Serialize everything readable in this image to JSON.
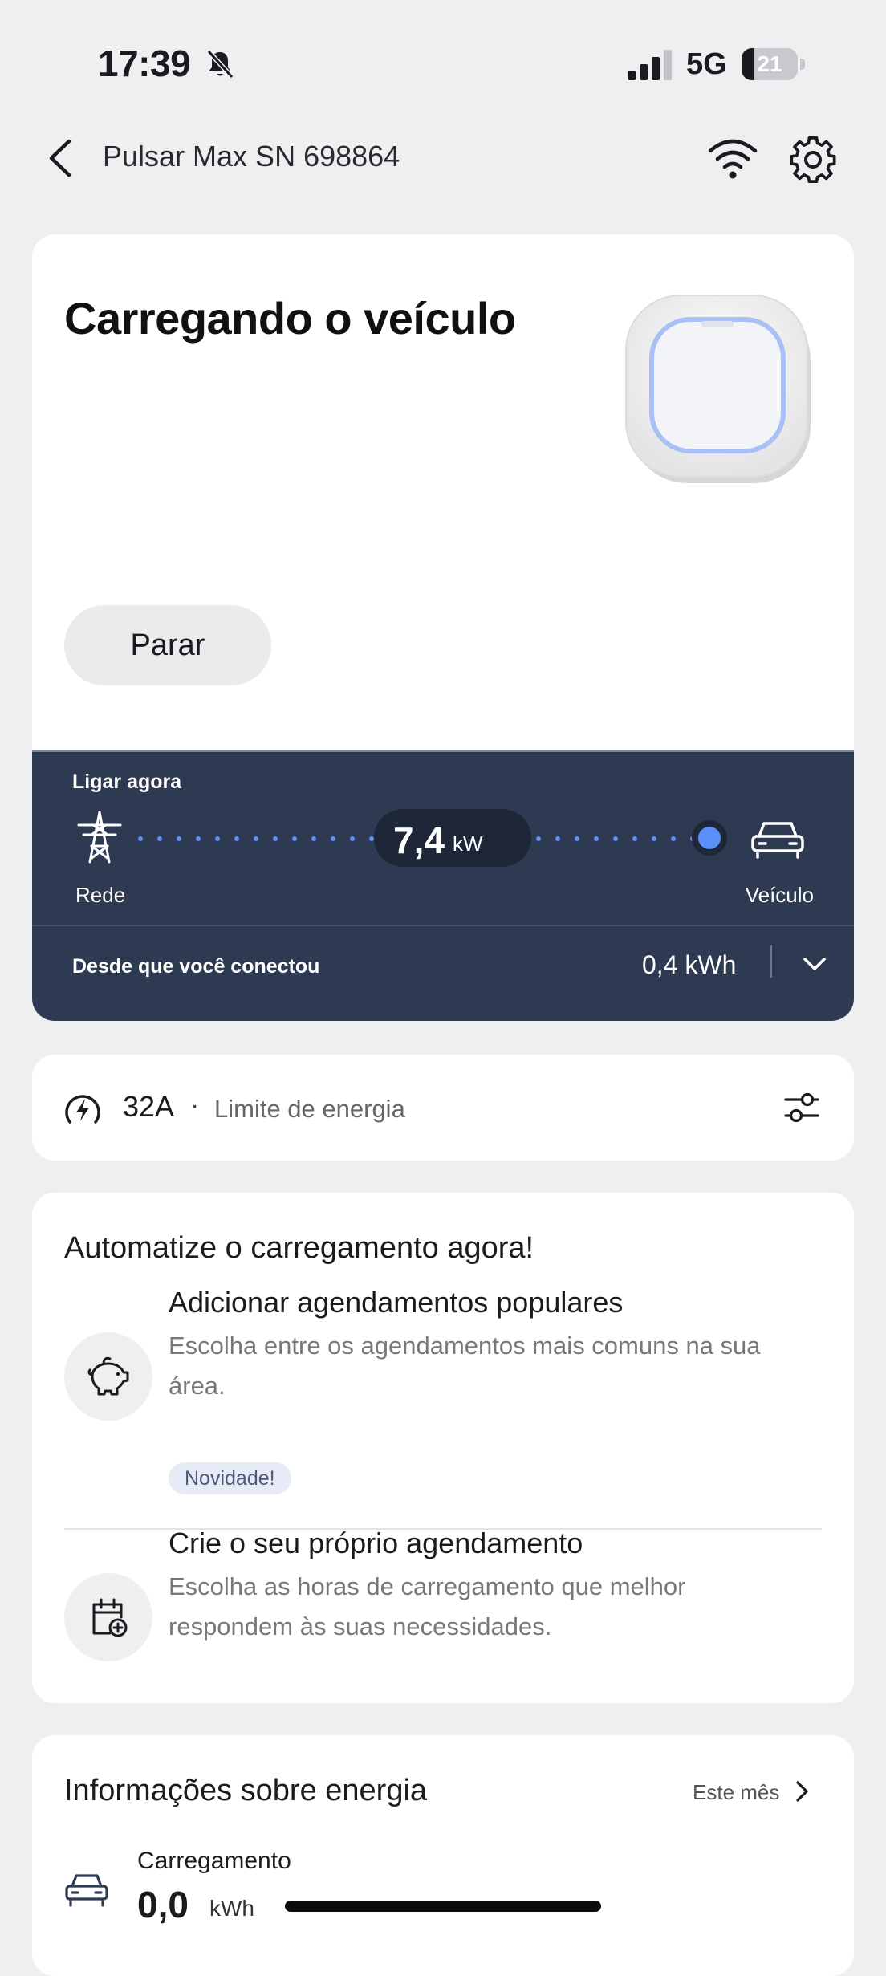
{
  "status_bar": {
    "time": "17:39",
    "network": "5G",
    "battery": "21",
    "battery_level": 0.21,
    "icons": [
      "bell-slash-icon",
      "signal-icon",
      "battery-icon"
    ]
  },
  "header": {
    "title": "Pulsar Max SN 698864",
    "icons": [
      "back-chevron-icon",
      "wifi-icon",
      "gear-icon"
    ]
  },
  "charging_card": {
    "title": "Carregando o veículo",
    "stop_label": "Parar",
    "flow": {
      "label": "Ligar agora",
      "power_value": "7,4",
      "power_unit": "kW",
      "source_label": "Rede",
      "target_label": "Veículo",
      "since_label": "Desde que você conectou",
      "since_value": "0,4 kWh"
    },
    "colors": {
      "panel": "#2d3a52",
      "accent": "#5b8ff9"
    }
  },
  "limit_card": {
    "amperage": "32A",
    "separator": "·",
    "label": "Limite de energia"
  },
  "automate_card": {
    "title": "Automatize o carregamento agora!",
    "items": [
      {
        "title": "Adicionar agendamentos populares",
        "description": "Escolha entre os agendamentos mais comuns na sua área.",
        "badge": "Novidade!",
        "icon": "piggy-bank-icon"
      },
      {
        "title": "Crie o seu próprio agendamento",
        "description": "Escolha as horas de carregamento que melhor respondem às suas necessidades.",
        "icon": "calendar-add-icon"
      }
    ]
  },
  "energy_card": {
    "title": "Informações sobre energia",
    "period": "Este mês",
    "item_label": "Carregamento",
    "item_value": "0,0",
    "item_unit": "kWh"
  }
}
